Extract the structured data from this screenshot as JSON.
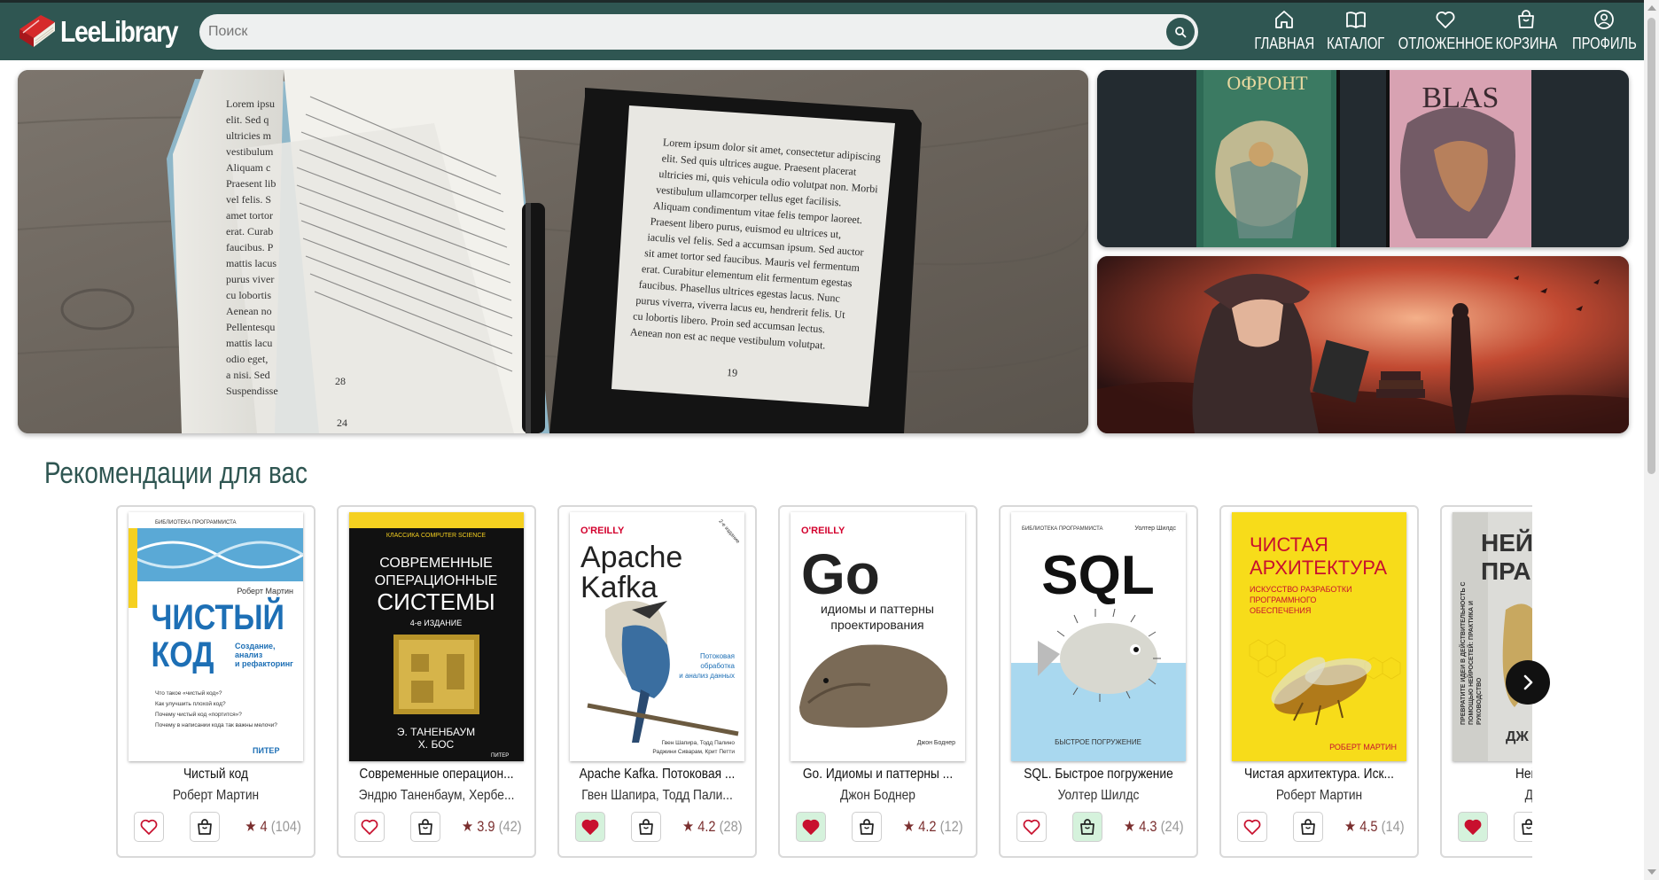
{
  "header": {
    "logo_text": "LeeLibrary",
    "search_placeholder": "Поиск",
    "nav": [
      {
        "label": "ГЛАВНАЯ",
        "icon": "home-icon"
      },
      {
        "label": "КАТАЛОГ",
        "icon": "book-open-icon"
      },
      {
        "label": "ОТЛОЖЕННОЕ",
        "icon": "heart-icon"
      },
      {
        "label": "КОРЗИНА",
        "icon": "shopping-bag-icon"
      },
      {
        "label": "ПРОФИЛЬ",
        "icon": "user-circle-icon"
      }
    ]
  },
  "banners": {
    "main_page_left": [
      "Lorem ipsu",
      "elit. Sed q",
      "ultricies m",
      "vestibulum",
      "Aliquam c",
      "Praesent lib",
      "vel felis. S",
      "amet tortor",
      "erat. Curab",
      "faucibus. P",
      "mattis lacus",
      "purus viver",
      "cu lobortis",
      "Aenean no",
      "Pellentesqu",
      "mattis lacu",
      "odio eget,",
      "a nisi. Sed",
      "Suspendisse"
    ],
    "reader_text": [
      "Lorem ipsum dolor sit amet, consectetur adipiscing",
      "elit. Sed quis ultrices augue. Praesent placerat",
      "ultricies mi, quis vehicula odio volutpat non. Morbi",
      "vestibulum ullamcorper tellus eget facilisis.",
      "Aliquam condimentum vitae felis tempor laoreet.",
      "Praesent libero purus, euismod eu ultrices ut,",
      "iaculis vel felis. Sed a accumsan ipsum. Sed auctor",
      "sit amet tortor sed faucibus. Mauris vel fermentum",
      "erat. Curabitur elementum elit fermentum egestas",
      "faucibus. Phasellus ultrices egestas lacus. Nunc",
      "purus viverra, viverra lacus eu, hendrerit felis. Ut",
      "cu lobortis libero. Proin sed accumsan lectus.",
      "Aenean non est ac neque vestibulum volutpat."
    ],
    "page_numbers": [
      "28",
      "19",
      "24"
    ],
    "cover_titles": [
      "ОФРОНТ",
      "BLAS"
    ]
  },
  "section_title": "Рекомендации для вас",
  "books": [
    {
      "title": "Чистый код",
      "author": "Роберт Мартин",
      "rating": "4",
      "count": "(104)",
      "fav": false,
      "cart": false
    },
    {
      "title": "Современные операцион...",
      "author": "Эндрю Таненбаум, Хербе...",
      "rating": "3.9",
      "count": "(42)",
      "fav": false,
      "cart": false
    },
    {
      "title": "Apache Kafka. Потоковая ...",
      "author": "Гвен Шапира, Тодд Пали...",
      "rating": "4.2",
      "count": "(28)",
      "fav": true,
      "cart": false
    },
    {
      "title": "Go. Идиомы и паттерны ...",
      "author": "Джон Боднер",
      "rating": "4.2",
      "count": "(12)",
      "fav": true,
      "cart": false
    },
    {
      "title": "SQL. Быстрое погружение",
      "author": "Уолтер Шилдс",
      "rating": "4.3",
      "count": "(24)",
      "fav": false,
      "cart": true
    },
    {
      "title": "Чистая архитектура. Иск...",
      "author": "Роберт Мартин",
      "rating": "4.5",
      "count": "(14)",
      "fav": false,
      "cart": false
    },
    {
      "title": "Нейросе",
      "author": "Джей",
      "rating": "",
      "count": "",
      "fav": true,
      "cart": false
    }
  ],
  "covers": {
    "c1": {
      "series": "БИБЛИОТЕКА ПРОГРАММИСТА",
      "author": "Роберт Мартин",
      "title1": "ЧИСТЫЙ",
      "title2": "КОД",
      "sub": [
        "Создание,",
        "анализ",
        "и рефакторинг"
      ],
      "bullets": [
        "Что такое «чистый код»?",
        "Как улучшить плохой код?",
        "Почему чистый код «портится»?",
        "Почему в написании кода так важны мелочи?"
      ],
      "pub": "ПИТЕР"
    },
    "c2": {
      "series": "КЛАССИКА COMPUTER SCIENCE",
      "t1": "СОВРЕМЕННЫЕ",
      "t2": "ОПЕРАЦИОННЫЕ",
      "t3": "СИСТЕМЫ",
      "ed": "4-е ИЗДАНИЕ",
      "a1": "Э. ТАНЕНБАУМ",
      "a2": "Х. БОС",
      "pub": "ПИТЕР"
    },
    "c3": {
      "brand": "O'REILLY",
      "ed": "2-е издание",
      "t1": "Apache",
      "t2": "Kafka",
      "sub": [
        "Потоковая",
        "обработка",
        "и анализ данных"
      ],
      "authors": [
        "Гвен Шапира, Тодд Палино",
        "Раджини Сиварам, Крит Петти"
      ]
    },
    "c4": {
      "brand": "O'REILLY",
      "t1": "Go",
      "sub": [
        "идиомы и паттерны",
        "проектирования"
      ],
      "author": "Джон Боднер"
    },
    "c5": {
      "series": "БИБЛИОТЕКА ПРОГРАММИСТА",
      "author": "Уолтер Шилдс",
      "t1": "SQL",
      "sub": "БЫСТРОЕ ПОГРУЖЕНИЕ"
    },
    "c6": {
      "t1": "ЧИСТАЯ",
      "t2": "АРХИТЕКТУРА",
      "sub": [
        "ИСКУССТВО РАЗРАБОТКИ",
        "ПРОГРАММНОГО",
        "ОБЕСПЕЧЕНИЯ"
      ],
      "author": "РОБЕРТ МАРТИН"
    },
    "c7": {
      "t1": "НЕЙ",
      "t2": "ПРАК",
      "side": [
        "ПРЕВРАТИТЕ ИДЕИ В ДЕЙСТВИТЕЛЬНОСТЬ С",
        "ПОМОЩЬЮ НЕЙРОСЕТЕЙ: ПРАКТИКА И",
        "РУКОВОДСТВО"
      ],
      "author": "ДЖ"
    }
  },
  "colors": {
    "header": "#2f5652",
    "accent_rating": "#7a2e2e",
    "fav_active_bg": "#d5f2dc",
    "fav_heart": "#c8102e"
  }
}
